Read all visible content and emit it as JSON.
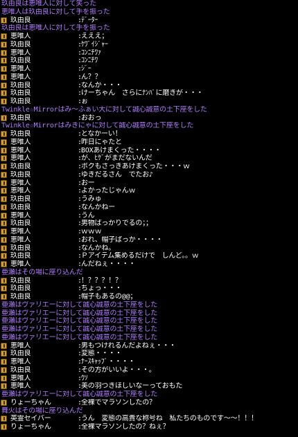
{
  "chat_log": {
    "separator": ":",
    "lines": [
      {
        "type": "emote",
        "text": "玖由良は恵唯人に対して笑った"
      },
      {
        "type": "emote",
        "text": "恵唯人は玖由良に対して手を振った"
      },
      {
        "type": "msg",
        "speaker": "玖由良",
        "text": "ﾃﾞｰﾀｰ"
      },
      {
        "type": "emote",
        "text": "玖由良は恵唯人に対して手を振った"
      },
      {
        "type": "msg",
        "speaker": "恵唯人",
        "text": "えええ；"
      },
      {
        "type": "msg",
        "speaker": "玖由良",
        "text": "ｹﾜﾞｲｼﾞｬｰ"
      },
      {
        "type": "msg",
        "speaker": "恵唯人",
        "text": "ｺﾝﾆﾁﾜｧ"
      },
      {
        "type": "msg",
        "speaker": "玖由良",
        "text": "ｺﾝﾆﾁﾜ"
      },
      {
        "type": "msg",
        "speaker": "恵唯人",
        "text": "ｼﾞｰ"
      },
      {
        "type": "msg",
        "speaker": "恵唯人",
        "text": "ん？？"
      },
      {
        "type": "msg",
        "speaker": "玖由良",
        "text": "なんか・・・"
      },
      {
        "type": "msg",
        "speaker": "玖由良",
        "text": "けーちゃん　さらにﾅﾝﾊﾟに磨きが・・・"
      },
      {
        "type": "msg",
        "speaker": "玖由良",
        "text": "ぉ"
      },
      {
        "type": "emote",
        "text": "Twinkle☆Mirrorはみ～ふぁい大に対して誠心誠意の土下座をした"
      },
      {
        "type": "msg",
        "speaker": "玖由良",
        "text": "おおっ"
      },
      {
        "type": "emote",
        "text": "Twinkle☆Mirrorはみきにゃに対して誠心誠意の土下座をした"
      },
      {
        "type": "msg",
        "speaker": "玖由良",
        "text": "となかーい！"
      },
      {
        "type": "msg",
        "speaker": "恵唯人",
        "text": "昨日にゃたと"
      },
      {
        "type": "msg",
        "speaker": "恵唯人",
        "text": "BOXあけまくった・・・・"
      },
      {
        "type": "msg",
        "speaker": "恵唯人",
        "text": "が、ﾋｹﾞがまだないんだ"
      },
      {
        "type": "msg",
        "speaker": "玖由良",
        "text": "ボクもさっきあけまくった・・・ｗ"
      },
      {
        "type": "msg",
        "speaker": "玖由良",
        "text": "ゆきだるさん　でたお♪"
      },
      {
        "type": "msg",
        "speaker": "恵唯人",
        "text": "おー"
      },
      {
        "type": "msg",
        "speaker": "恵唯人",
        "text": "よかったじゃんｗ"
      },
      {
        "type": "msg",
        "speaker": "玖由良",
        "text": "うみゅ"
      },
      {
        "type": "msg",
        "speaker": "玖由良",
        "text": "なんかねー"
      },
      {
        "type": "msg",
        "speaker": "恵唯人",
        "text": "うん"
      },
      {
        "type": "msg",
        "speaker": "玖由良",
        "text": "男物ばっかりでるの；；"
      },
      {
        "type": "msg",
        "speaker": "恵唯人",
        "text": "ｗｗｗ"
      },
      {
        "type": "msg",
        "speaker": "恵唯人",
        "text": "おれ、帽子ばっか・・・・"
      },
      {
        "type": "msg",
        "speaker": "玖由良",
        "text": "なんかね。"
      },
      {
        "type": "msg",
        "speaker": "玖由良",
        "text": "Ｐアイテム集めるだけで　しんど。。ｗ"
      },
      {
        "type": "msg",
        "speaker": "恵唯人",
        "text": "んだねぇ・・・・"
      },
      {
        "type": "emote",
        "text": "亜瀬はその場に座り込んだ"
      },
      {
        "type": "msg",
        "speaker": "玖由良",
        "text": "！？？？！？"
      },
      {
        "type": "msg",
        "speaker": "玖由良",
        "text": "ちょっ・・・"
      },
      {
        "type": "msg",
        "speaker": "玖由良",
        "text": "帽子もあるの@@；"
      },
      {
        "type": "emote",
        "text": "亜瀬はヴァリエーに対して誠心誠意の土下座をした"
      },
      {
        "type": "emote",
        "text": "亜瀬はヴァリエーに対して誠心誠意の土下座をした"
      },
      {
        "type": "emote",
        "text": "亜瀬はヴァリエーに対して誠心誠意の土下座をした"
      },
      {
        "type": "emote",
        "text": "亜瀬はヴァリエーに対して誠心誠意の土下座をした"
      },
      {
        "type": "emote",
        "text": "亜瀬はヴァリエーに対して誠心誠意の土下座をした"
      },
      {
        "type": "msg",
        "speaker": "恵唯人",
        "text": "男もつけれるんだよねぇ・・・"
      },
      {
        "type": "msg",
        "speaker": "玖由良",
        "text": "変態・・・・"
      },
      {
        "type": "msg",
        "speaker": "恵唯人",
        "text": "ﾅｰｽｷｬｯﾌﾟ・・・・"
      },
      {
        "type": "msg",
        "speaker": "玖由良",
        "text": "その方がいいよ・・・。"
      },
      {
        "type": "msg",
        "speaker": "恵唯人",
        "text": "ｳｿ"
      },
      {
        "type": "msg",
        "speaker": "恵唯人",
        "text": "美の羽つきほしいなーっておもた"
      },
      {
        "type": "emote",
        "text": "亜瀬はヴァリエーに対して誠心誠意の土下座をした"
      },
      {
        "type": "msg",
        "speaker": "りょーちゃん",
        "text": "全裸でマラソンしたの？"
      },
      {
        "type": "emote",
        "text": "舞火はその場に座り込んだ"
      },
      {
        "type": "msg",
        "speaker": "英霊セイバー",
        "text": "うん　変態の高貴な称号ね　私たちのものです～～！！！"
      },
      {
        "type": "msg",
        "speaker": "りょーちゃん",
        "text": "全裸マラソンしたの？ねぇ？"
      }
    ]
  }
}
